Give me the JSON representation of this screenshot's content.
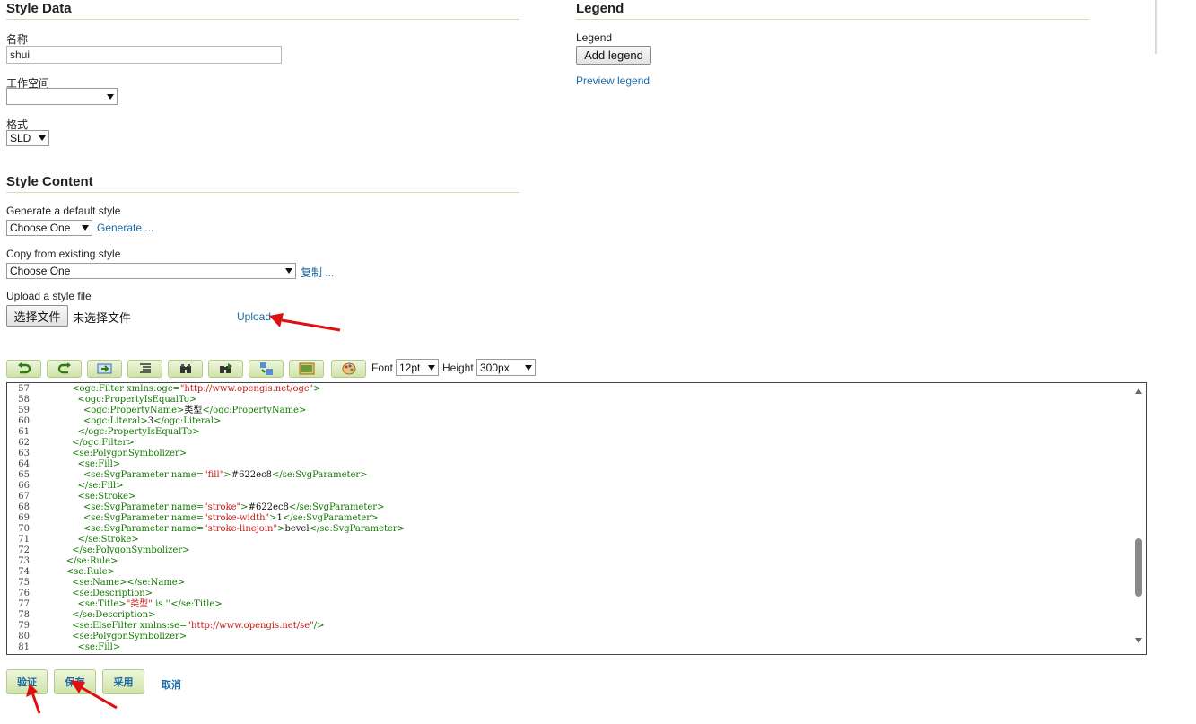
{
  "style_data": {
    "title": "Style Data",
    "name_label": "名称",
    "name_value": "shui",
    "workspace_label": "工作空间",
    "workspace_value": "",
    "format_label": "格式",
    "format_value": "SLD"
  },
  "legend": {
    "title": "Legend",
    "label": "Legend",
    "add_button": "Add legend",
    "preview_link": "Preview legend"
  },
  "style_content": {
    "title": "Style Content",
    "generate_label": "Generate a default style",
    "generate_select": "Choose One",
    "generate_link": "Generate ...",
    "copy_label": "Copy from existing style",
    "copy_select": "Choose One",
    "copy_link": "复制 ...",
    "upload_label": "Upload a style file",
    "file_button": "选择文件",
    "file_status": "未选择文件",
    "upload_link": "Upload"
  },
  "toolbar": {
    "font_label": "Font",
    "font_value": "12pt",
    "height_label": "Height",
    "height_value": "300px",
    "buttons": [
      "undo-icon",
      "redo-icon",
      "go-to-line-icon",
      "reindent-icon",
      "find-icon",
      "replace-icon",
      "format-icon",
      "image-icon",
      "palette-icon"
    ]
  },
  "editor": {
    "lines": [
      {
        "n": "57",
        "t": "            <ogc:Filter xmlns:ogc=\"http://www.opengis.net/ogc\">"
      },
      {
        "n": "58",
        "t": "              <ogc:PropertyIsEqualTo>"
      },
      {
        "n": "59",
        "t": "                <ogc:PropertyName>类型</ogc:PropertyName>"
      },
      {
        "n": "60",
        "t": "                <ogc:Literal>3</ogc:Literal>"
      },
      {
        "n": "61",
        "t": "              </ogc:PropertyIsEqualTo>"
      },
      {
        "n": "62",
        "t": "            </ogc:Filter>"
      },
      {
        "n": "63",
        "t": "            <se:PolygonSymbolizer>"
      },
      {
        "n": "64",
        "t": "              <se:Fill>"
      },
      {
        "n": "65",
        "t": "                <se:SvgParameter name=\"fill\">#622ec8</se:SvgParameter>"
      },
      {
        "n": "66",
        "t": "              </se:Fill>"
      },
      {
        "n": "67",
        "t": "              <se:Stroke>"
      },
      {
        "n": "68",
        "t": "                <se:SvgParameter name=\"stroke\">#622ec8</se:SvgParameter>"
      },
      {
        "n": "69",
        "t": "                <se:SvgParameter name=\"stroke-width\">1</se:SvgParameter>"
      },
      {
        "n": "70",
        "t": "                <se:SvgParameter name=\"stroke-linejoin\">bevel</se:SvgParameter>"
      },
      {
        "n": "71",
        "t": "              </se:Stroke>"
      },
      {
        "n": "72",
        "t": "            </se:PolygonSymbolizer>"
      },
      {
        "n": "73",
        "t": "          </se:Rule>"
      },
      {
        "n": "74",
        "t": "          <se:Rule>"
      },
      {
        "n": "75",
        "t": "            <se:Name></se:Name>"
      },
      {
        "n": "76",
        "t": "            <se:Description>"
      },
      {
        "n": "77",
        "t": "              <se:Title>\"类型\" is ''</se:Title>"
      },
      {
        "n": "78",
        "t": "            </se:Description>"
      },
      {
        "n": "79",
        "t": "            <se:ElseFilter xmlns:se=\"http://www.opengis.net/se\"/>"
      },
      {
        "n": "80",
        "t": "            <se:PolygonSymbolizer>"
      },
      {
        "n": "81",
        "t": "              <se:Fill>"
      }
    ]
  },
  "actions": {
    "validate": "验证",
    "save": "保存",
    "apply": "采用",
    "cancel": "取消"
  },
  "colors": {
    "accent_link": "#1a6aa6",
    "code_green": "#117700",
    "annotation_red": "#e01010"
  }
}
